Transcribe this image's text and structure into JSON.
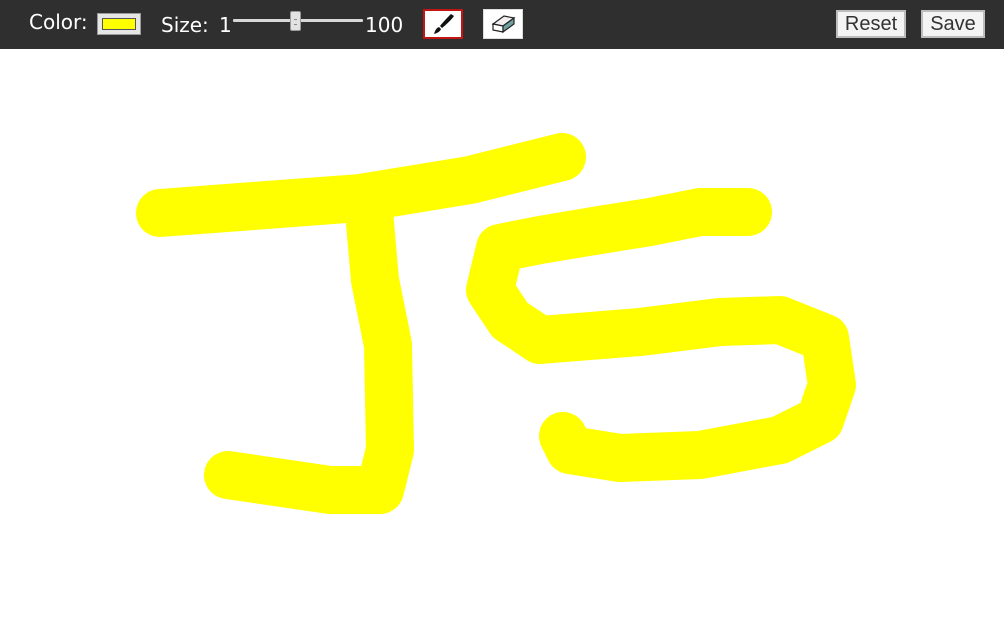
{
  "toolbar": {
    "color_label": "Color:",
    "size_label": "Size:",
    "size_min": "1",
    "size_max": "100",
    "reset_label": "Reset",
    "save_label": "Save"
  },
  "brush": {
    "color": "#ffff00",
    "size_fraction": 0.48,
    "active_tool": "brush"
  },
  "tools": [
    {
      "name": "brush-icon",
      "active": true
    },
    {
      "name": "eraser-icon",
      "active": false
    }
  ],
  "colors": {
    "toolbar_bg": "#2f2f2f",
    "active_tool_border": "#c31414",
    "canvas_bg": "#ffffff"
  }
}
